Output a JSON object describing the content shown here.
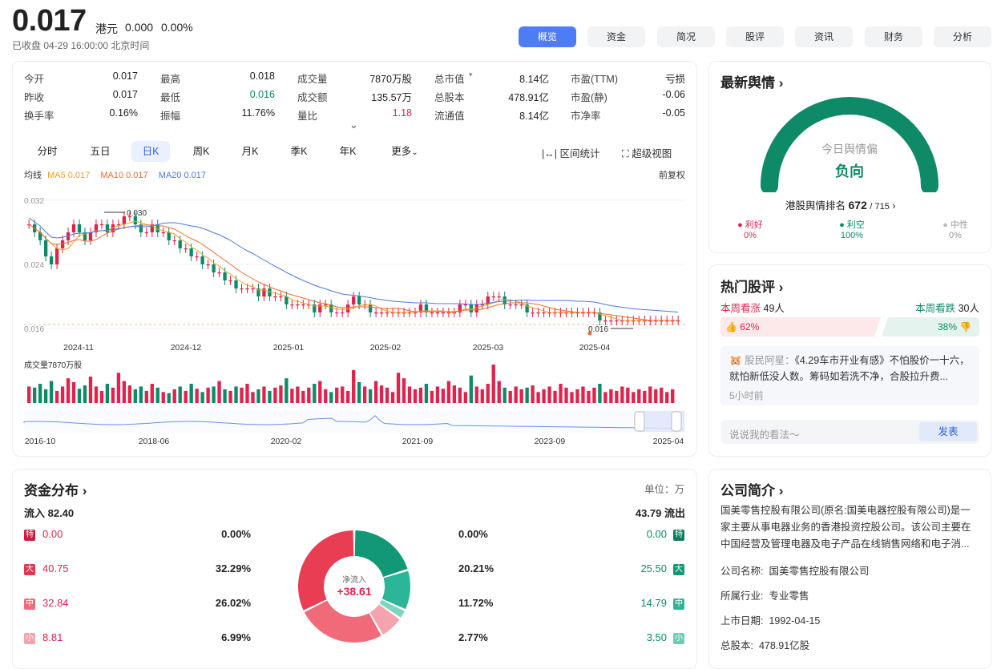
{
  "header": {
    "price": "0.017",
    "currency": "港元",
    "change": "0.000",
    "change_pct": "0.00%",
    "status": "已收盘  04-29 16:00:00  北京时间"
  },
  "tabs": [
    "概览",
    "资金",
    "简况",
    "股评",
    "资讯",
    "财务",
    "分析"
  ],
  "quote": {
    "rows": [
      [
        {
          "l": "今开",
          "v": "0.017",
          "c": ""
        },
        {
          "l": "最高",
          "v": "0.018",
          "c": ""
        },
        {
          "l": "成交量",
          "v": "7870万股",
          "c": ""
        },
        {
          "l": "总市值",
          "v": "8.14亿",
          "c": ""
        },
        {
          "l": "市盈(TTM)",
          "v": "亏损",
          "c": ""
        }
      ],
      [
        {
          "l": "昨收",
          "v": "0.017",
          "c": ""
        },
        {
          "l": "最低",
          "v": "0.016",
          "c": "green"
        },
        {
          "l": "成交额",
          "v": "135.57万",
          "c": ""
        },
        {
          "l": "总股本",
          "v": "478.91亿",
          "c": ""
        },
        {
          "l": "市盈(静)",
          "v": "-0.06",
          "c": ""
        }
      ],
      [
        {
          "l": "换手率",
          "v": "0.16%",
          "c": ""
        },
        {
          "l": "振幅",
          "v": "11.76%",
          "c": ""
        },
        {
          "l": "量比",
          "v": "1.18",
          "c": "red"
        },
        {
          "l": "流通值",
          "v": "8.14亿",
          "c": ""
        },
        {
          "l": "市净率",
          "v": "-0.05",
          "c": ""
        }
      ]
    ],
    "mktcap_arrow": "▾",
    "expand_icon": "⌄"
  },
  "period_tabs": [
    "分时",
    "五日",
    "日K",
    "周K",
    "月K",
    "季K",
    "年K",
    "更多"
  ],
  "tools": {
    "range": "区间统计",
    "super": "超级视图",
    "fuquan": "前复权"
  },
  "ma": {
    "label": "均线",
    "ma5": "MA5 0.017",
    "ma10": "MA10 0.017",
    "ma20": "MA20 0.017",
    "ma5_color": "#f0a020",
    "ma10_color": "#f06a30",
    "ma20_color": "#4a78e0"
  },
  "chart_data": {
    "type": "line",
    "title": "",
    "ylabels": [
      "0.032",
      "0.024",
      "0.016"
    ],
    "xlabels": [
      "2024-11",
      "2024-12",
      "2025-01",
      "2025-02",
      "2025-03",
      "2025-04"
    ],
    "high_label": "0.030",
    "low_label": "0.016",
    "volume_label": "成交量7870万股",
    "overview_labels": [
      "2016-10",
      "2018-06",
      "2020-02",
      "2021-09",
      "2023-09",
      "2025-04"
    ],
    "close": [
      0.029,
      0.028,
      0.027,
      0.025,
      0.024,
      0.026,
      0.027,
      0.028,
      0.029,
      0.028,
      0.027,
      0.028,
      0.029,
      0.029,
      0.028,
      0.029,
      0.029,
      0.03,
      0.03,
      0.029,
      0.028,
      0.028,
      0.029,
      0.028,
      0.028,
      0.027,
      0.027,
      0.026,
      0.026,
      0.025,
      0.025,
      0.024,
      0.024,
      0.023,
      0.023,
      0.022,
      0.022,
      0.021,
      0.021,
      0.021,
      0.021,
      0.02,
      0.021,
      0.02,
      0.02,
      0.02,
      0.019,
      0.019,
      0.019,
      0.019,
      0.019,
      0.018,
      0.019,
      0.019,
      0.018,
      0.018,
      0.018,
      0.019,
      0.02,
      0.019,
      0.019,
      0.018,
      0.018,
      0.018,
      0.018,
      0.018,
      0.018,
      0.018,
      0.018,
      0.018,
      0.019,
      0.018,
      0.018,
      0.018,
      0.018,
      0.018,
      0.018,
      0.019,
      0.019,
      0.018,
      0.019,
      0.019,
      0.02,
      0.02,
      0.02,
      0.019,
      0.019,
      0.019,
      0.019,
      0.018,
      0.018,
      0.018,
      0.018,
      0.018,
      0.018,
      0.018,
      0.018,
      0.018,
      0.018,
      0.018,
      0.018,
      0.018,
      0.017,
      0.017,
      0.017,
      0.017,
      0.017,
      0.017,
      0.017,
      0.017,
      0.017,
      0.017,
      0.017,
      0.017,
      0.017,
      0.017,
      0.017
    ],
    "volume": [
      30,
      28,
      35,
      25,
      40,
      22,
      30,
      45,
      38,
      26,
      32,
      48,
      30,
      22,
      35,
      28,
      55,
      40,
      32,
      25,
      30,
      22,
      35,
      28,
      20,
      18,
      25,
      30,
      22,
      35,
      26,
      20,
      28,
      30,
      40,
      25,
      22,
      30,
      28,
      35,
      20,
      25,
      30,
      22,
      28,
      32,
      45,
      26,
      30,
      22,
      28,
      35,
      40,
      25,
      20,
      28,
      30,
      22,
      60,
      38,
      30,
      25,
      40,
      32,
      28,
      20,
      55,
      45,
      30,
      25,
      28,
      35,
      22,
      30,
      26,
      40,
      32,
      28,
      20,
      50,
      30,
      25,
      35,
      70,
      40,
      28,
      22,
      30,
      25,
      28,
      32,
      20,
      25,
      30,
      22,
      35,
      28,
      20,
      25,
      30,
      22,
      28,
      35,
      20,
      25,
      22,
      30,
      28,
      20,
      25,
      22,
      30,
      25,
      28,
      20,
      25
    ]
  },
  "sentiment": {
    "title": "最新舆情",
    "gauge_caption": "今日舆情偏",
    "gauge_value": "负向",
    "rank_label": "港股舆情排名",
    "rank": "672",
    "rank_total": "/ 715",
    "good_label": "利好",
    "good_pct": "0%",
    "bad_label": "利空",
    "bad_pct": "100%",
    "neutral_label": "中性",
    "neutral_pct": "0%",
    "negative_ratio": 1.0
  },
  "comments": {
    "title": "热门股评",
    "up_label": "本周看涨",
    "up_count": "49人",
    "down_label": "本周看跌",
    "down_count": "30人",
    "up_pct": "62%",
    "down_pct": "38%",
    "author": "股民阿星：",
    "text": "《4.29车市开业有感》不怕股价一十六，就怕新低没人数。筹码如若洗不净，合股拉升费...",
    "time": "5小时前",
    "input_placeholder": "说说我的看法～",
    "submit": "发表"
  },
  "capital": {
    "title": "资金分布",
    "unit": "单位：万",
    "inflow": "流入 82.40",
    "outflow": "43.79 流出",
    "net_label": "净流入",
    "net_value": "+38.61",
    "rows": [
      {
        "badge": "特",
        "in": "0.00",
        "in_pct": "0.00%",
        "out_pct": "0.00%",
        "out": "0.00"
      },
      {
        "badge": "大",
        "in": "40.75",
        "in_pct": "32.29%",
        "out_pct": "20.21%",
        "out": "25.50"
      },
      {
        "badge": "中",
        "in": "32.84",
        "in_pct": "26.02%",
        "out_pct": "11.72%",
        "out": "14.79"
      },
      {
        "badge": "小",
        "in": "8.81",
        "in_pct": "6.99%",
        "out_pct": "2.77%",
        "out": "3.50"
      }
    ],
    "donut": [
      {
        "v": 0.0,
        "color": "#c81e3c"
      },
      {
        "v": 32.29,
        "color": "#e83d53"
      },
      {
        "v": 26.02,
        "color": "#f06a7a"
      },
      {
        "v": 6.99,
        "color": "#f5a3ad"
      },
      {
        "v": 2.77,
        "color": "#7fd4bf"
      },
      {
        "v": 11.72,
        "color": "#2db597"
      },
      {
        "v": 20.21,
        "color": "#139877"
      }
    ]
  },
  "company": {
    "title": "公司简介",
    "desc": "国美零售控股有限公司(原名:国美电器控股有限公司)是一家主要从事电器业务的香港投资控股公司。该公司主要在中国经营及管理电器及电子产品在线销售网络和电子消...",
    "name_label": "公司名称:",
    "name": "国美零售控股有限公司",
    "industry_label": "所属行业:",
    "industry": "专业零售",
    "ipo_label": "上市日期:",
    "ipo": "1992-04-15",
    "shares_label": "总股本:",
    "shares": "478.91亿股"
  }
}
